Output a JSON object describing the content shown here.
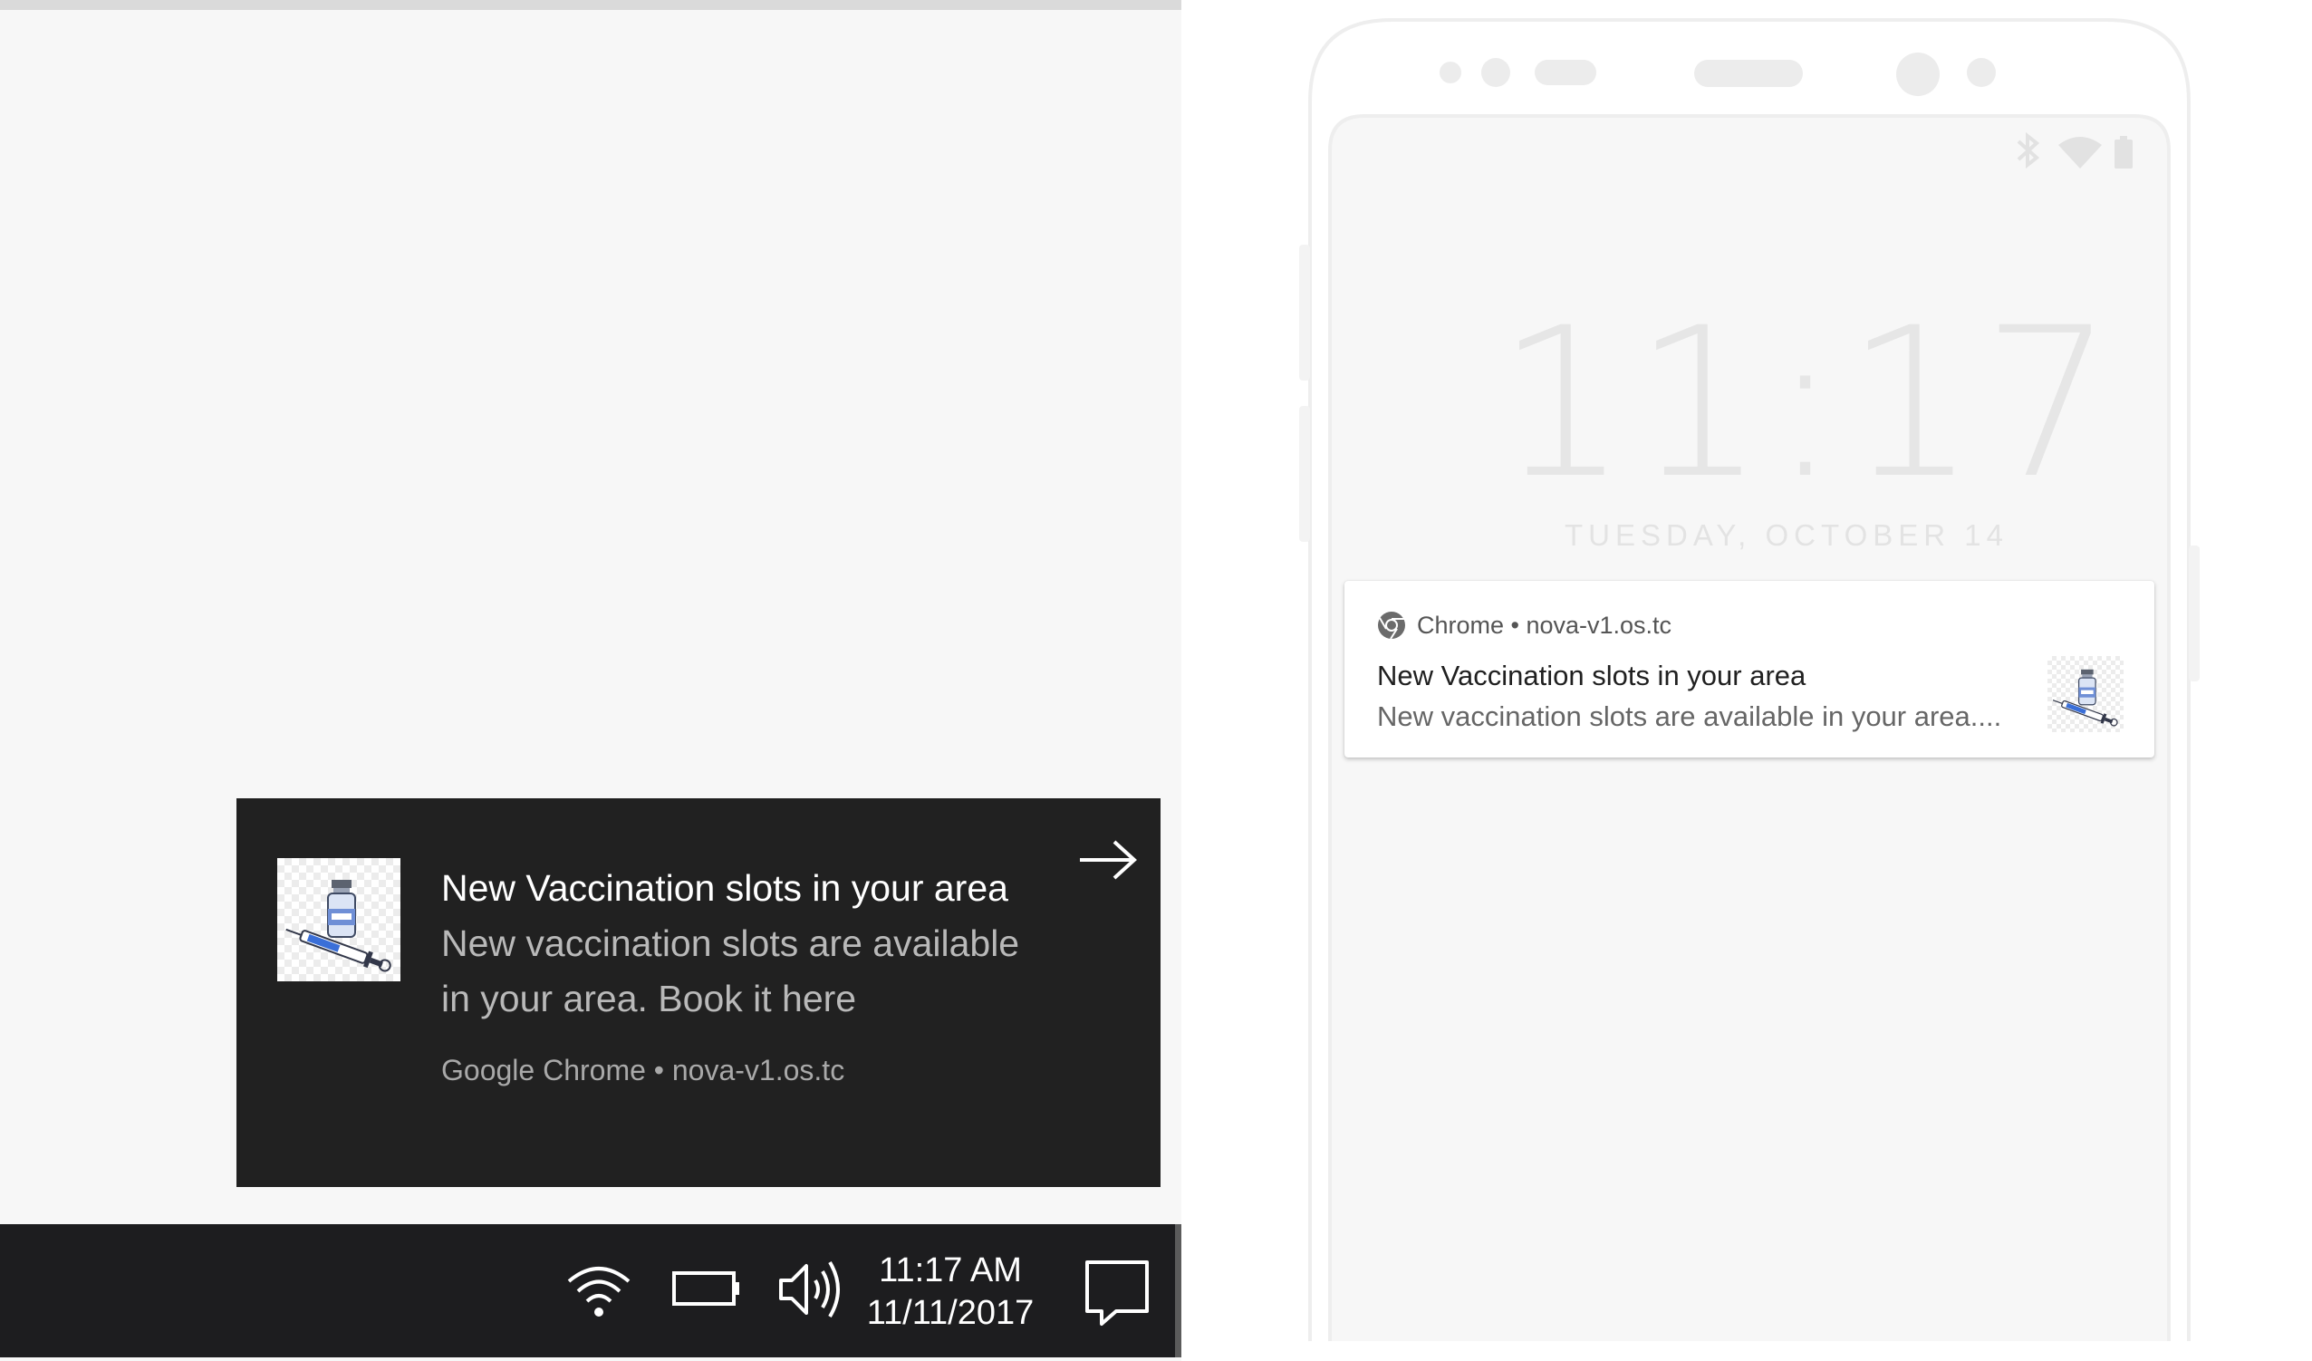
{
  "windows": {
    "toast": {
      "title": "New Vaccination slots in your area",
      "body": "New vaccination slots are available in your area. Book it here",
      "source": "Google Chrome • nova-v1.os.tc",
      "dismiss_icon": "arrow-right-icon",
      "image_icon": "vaccine-vial-syringe-icon"
    },
    "taskbar": {
      "time": "11:17 AM",
      "date": "11/11/2017",
      "icons": [
        "wifi-icon",
        "battery-icon",
        "volume-icon",
        "action-center-icon"
      ]
    }
  },
  "android": {
    "lockscreen": {
      "time": "11:17",
      "date": "TUESDAY, OCTOBER 14",
      "status_icons": [
        "bluetooth-icon",
        "wifi-icon",
        "battery-icon"
      ]
    },
    "notification": {
      "header": "Chrome • nova-v1.os.tc",
      "title": "New Vaccination slots in your area",
      "text": "New vaccination slots are available in your area....",
      "app_icon": "chrome-icon",
      "image_icon": "vaccine-vial-syringe-icon"
    }
  },
  "colors": {
    "toast_bg": "#212121",
    "taskbar_bg": "#1d1d1f",
    "desktop_bg": "#f7f7f7",
    "phone_outline": "#eeeeee"
  }
}
